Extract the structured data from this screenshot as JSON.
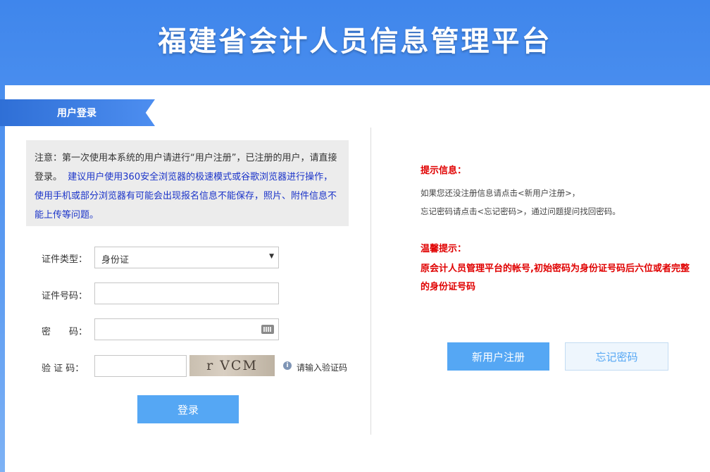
{
  "header": {
    "title": "福建省会计人员信息管理平台"
  },
  "tab": {
    "label": "用户登录"
  },
  "notice": {
    "plain": "注意：第一次使用本系统的用户请进行“用户注册”，已注册的用户，请直接登录。",
    "highlight": "建议用户使用360安全浏览器的极速模式或谷歌浏览器进行操作，使用手机或部分浏览器有可能会出现报名信息不能保存，照片、附件信息不能上传等问题。"
  },
  "form": {
    "id_type_label": "证件类型：",
    "id_type_value": "身份证",
    "id_number_label": "证件号码：",
    "id_number_value": "",
    "password_label": "密　　码：",
    "password_value": "",
    "captcha_label": "验 证 码：",
    "captcha_value": "",
    "captcha_text": "r VCM",
    "captcha_hint": "请输入验证码",
    "login_button": "登录"
  },
  "tips": {
    "title": "提示信息：",
    "line1": "如果您还没注册信息请点击<新用户注册>，",
    "line2": "忘记密码请点击<忘记密码>，通过问题提问找回密码。"
  },
  "warm": {
    "title": "温馨提示：",
    "text": "原会计人员管理平台的帐号,初始密码为身份证号码后六位或者完整的身份证号码"
  },
  "actions": {
    "register_button": "新用户注册",
    "forgot_button": "忘记密码"
  }
}
